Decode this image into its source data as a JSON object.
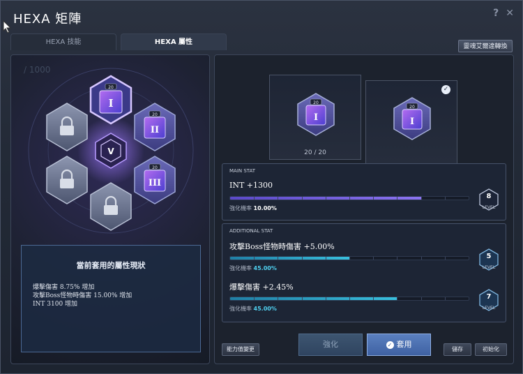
{
  "window": {
    "title": "HEXA 矩陣",
    "help_icon": "?",
    "close_icon": "✕"
  },
  "tabs": [
    {
      "label": "HEXA 技能",
      "active": false
    },
    {
      "label": "HEXA 屬性",
      "active": true
    }
  ],
  "soul_button": "靈魂艾爾達轉換",
  "left": {
    "background_text": "/ 1000",
    "nodes": [
      {
        "level": "20",
        "numeral": "I",
        "state": "selected"
      },
      {
        "level": "20",
        "numeral": "II",
        "state": "active"
      },
      {
        "level": "20",
        "numeral": "III",
        "state": "active"
      },
      {
        "state": "locked"
      },
      {
        "state": "locked"
      },
      {
        "state": "locked"
      }
    ],
    "status_title": "當前套用的屬性現狀",
    "status_lines": [
      "爆擊傷害 8.75% 增加",
      "攻擊Boss怪物時傷害 15.00% 增加",
      "INT 3100 增加"
    ]
  },
  "right": {
    "slot1": {
      "level": "20",
      "numeral": "I",
      "count": "20 / 20"
    },
    "slot2": {
      "level": "20",
      "numeral": "I",
      "checked": true
    },
    "main": {
      "label": "MAIN STAT",
      "name": "INT +1300",
      "rate_label": "強化機率",
      "rate_value": "10.00%",
      "progress": 0.8,
      "level": "8",
      "level_label": "LEVEL"
    },
    "additional": {
      "label": "ADDITIONAL STAT",
      "stats": [
        {
          "name": "攻擊Boss怪物時傷害 +5.00%",
          "rate_label": "強化機率",
          "rate_value": "45.00%",
          "progress": 0.5,
          "level": "5",
          "level_label": "LEVEL"
        },
        {
          "name": "爆擊傷害 +2.45%",
          "rate_label": "強化機率",
          "rate_value": "45.00%",
          "progress": 0.7,
          "level": "7",
          "level_label": "LEVEL"
        }
      ]
    },
    "buttons": {
      "change": "能力值變更",
      "enhance": "強化",
      "apply": "套用",
      "save": "儲存",
      "reset": "初始化"
    }
  },
  "colors": {
    "main_bar": "#7d66e6",
    "additional_bar": "#38c0de",
    "apply_button": "#4a6fb2"
  }
}
